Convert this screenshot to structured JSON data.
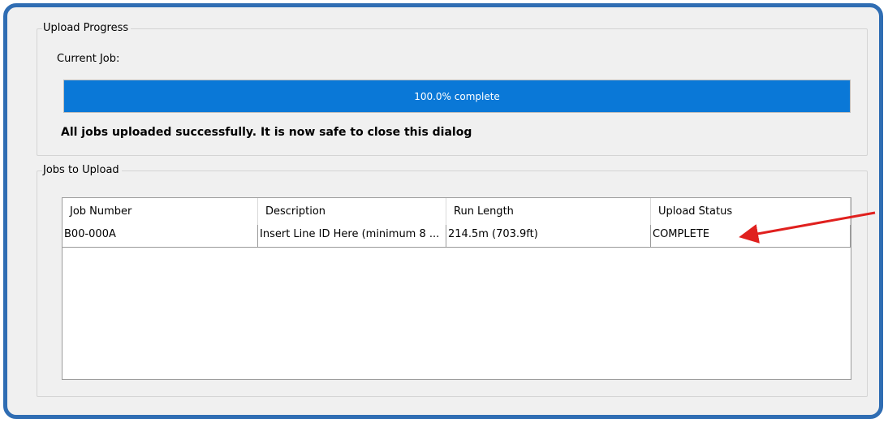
{
  "upload_progress": {
    "group_title": "Upload Progress",
    "current_job_label": "Current Job:",
    "progress_fraction": 1.0,
    "progress_text": "100.0% complete",
    "status_message": "All jobs uploaded successfully. It is now safe to close this dialog"
  },
  "jobs_to_upload": {
    "group_title": "Jobs to Upload",
    "columns": [
      "Job Number",
      "Description",
      "Run Length",
      "Upload Status"
    ],
    "rows": [
      {
        "job_number": "B00-000A",
        "description": "Insert Line ID Here (minimum 8 ...",
        "run_length": "214.5m (703.9ft)",
        "upload_status": "COMPLETE"
      }
    ]
  },
  "colors": {
    "frame_border": "#2f6db3",
    "progress_fill": "#0a78d7",
    "annotation_arrow": "#e0201e"
  }
}
